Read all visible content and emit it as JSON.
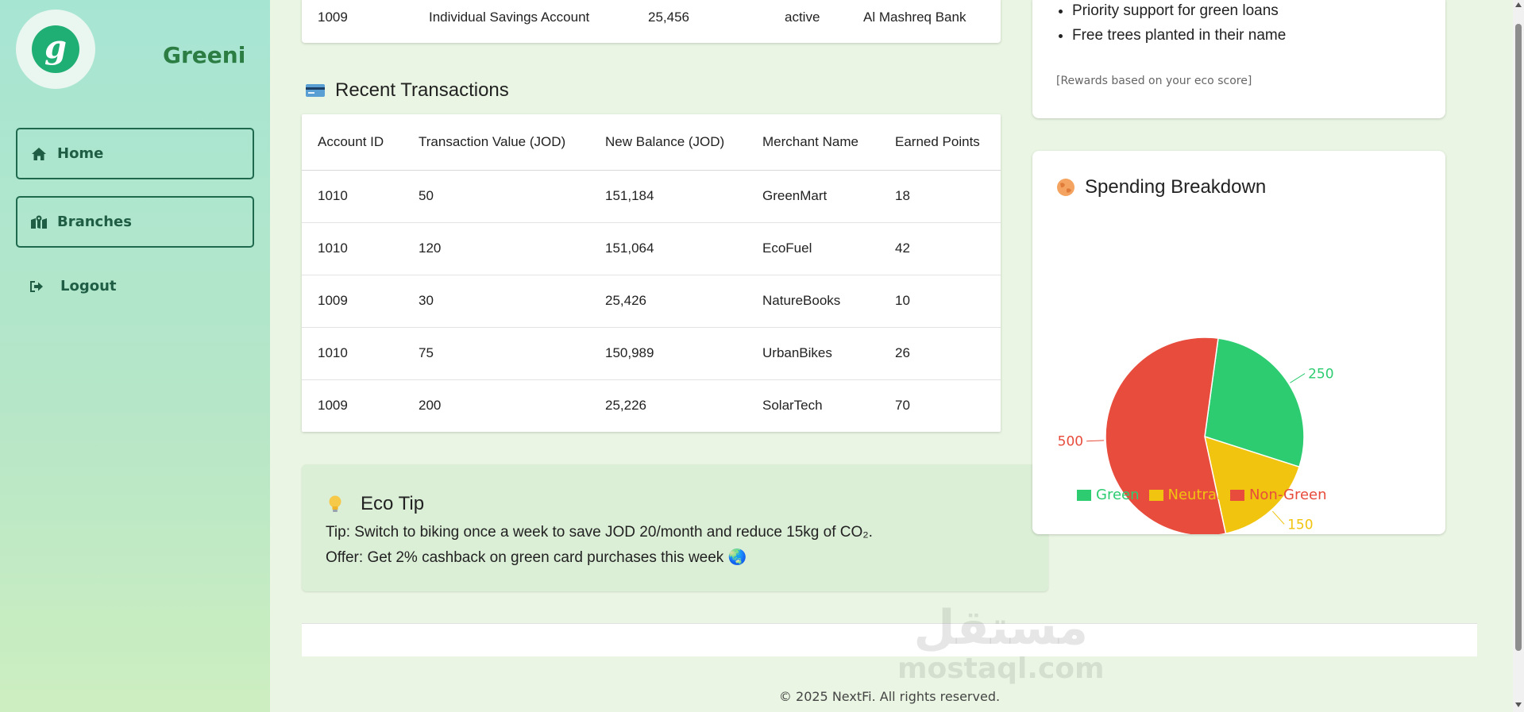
{
  "sidebar": {
    "brand": "Greeni",
    "logo_letter": "g",
    "nav": [
      {
        "label": "Home",
        "icon": "home-icon"
      },
      {
        "label": "Branches",
        "icon": "map-pin-icon"
      },
      {
        "label": "Logout",
        "icon": "sign-out-icon"
      }
    ]
  },
  "accounts": {
    "row": {
      "id": "1009",
      "type": "Individual Savings Account",
      "balance": "25,456",
      "status": "active",
      "bank": "Al Mashreq Bank"
    }
  },
  "transactions": {
    "title": "Recent Transactions",
    "icon": "credit-card-icon",
    "columns": [
      "Account ID",
      "Transaction Value (JOD)",
      "New Balance (JOD)",
      "Merchant Name",
      "Earned Points"
    ],
    "rows": [
      [
        "1010",
        "50",
        "151,184",
        "GreenMart",
        "18"
      ],
      [
        "1010",
        "120",
        "151,064",
        "EcoFuel",
        "42"
      ],
      [
        "1009",
        "30",
        "25,426",
        "NatureBooks",
        "10"
      ],
      [
        "1010",
        "75",
        "150,989",
        "UrbanBikes",
        "26"
      ],
      [
        "1009",
        "200",
        "25,226",
        "SolarTech",
        "70"
      ]
    ]
  },
  "eco_tip": {
    "title": "Eco Tip",
    "icon": "lightbulb-icon",
    "tip": "Tip: Switch to biking once a week to save JOD 20/month and reduce 15kg of CO₂.",
    "offer": "Offer: Get 2% cashback on green card purchases this week 🌏"
  },
  "rewards": {
    "items": [
      "Priority support for green loans",
      "Free trees planted in their name"
    ],
    "note": "[Rewards based on your eco score]"
  },
  "spending": {
    "title": "Spending Breakdown",
    "icon": "globe-icon"
  },
  "chart_data": {
    "type": "pie",
    "title": "Spending Breakdown",
    "categories": [
      "Green",
      "Neutral",
      "Non-Green"
    ],
    "values": [
      250,
      150,
      500
    ],
    "colors": [
      "#2ecc71",
      "#f1c40f",
      "#e74c3c"
    ],
    "legend": "bottom"
  },
  "footer": {
    "copyright": "© 2025 NextFi. All rights reserved.",
    "watermark_ar": "مستقل",
    "watermark_en": "mostaql.com"
  }
}
